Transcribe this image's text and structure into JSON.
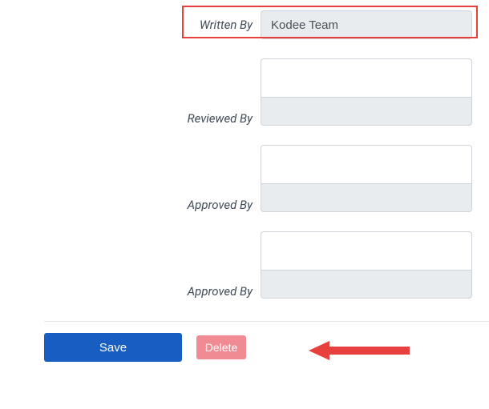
{
  "fields": {
    "writtenBy": {
      "label": "Written By",
      "value": "Kodee Team"
    },
    "reviewedBy": {
      "label": "Reviewed By",
      "value": ""
    },
    "approvedBy1": {
      "label": "Approved By",
      "value": ""
    },
    "approvedBy2": {
      "label": "Approved By",
      "value": ""
    }
  },
  "buttons": {
    "save": "Save",
    "delete": "Delete"
  },
  "annotation": {
    "arrowColor": "#e8403c"
  }
}
